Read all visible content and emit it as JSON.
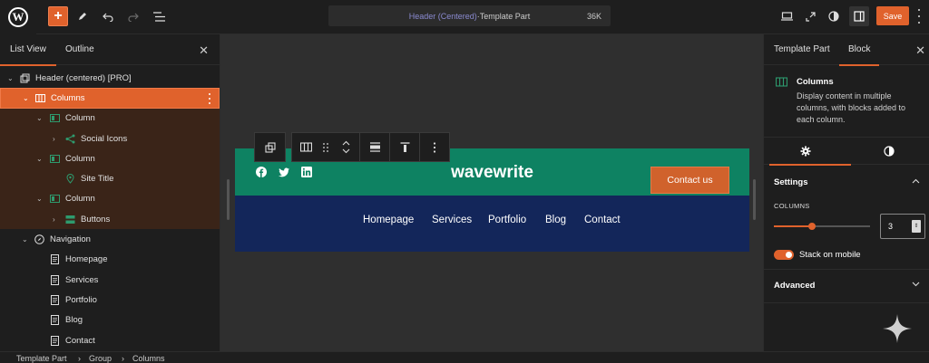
{
  "topbar": {
    "doc_title_part1": "Header (Centered)",
    "doc_title_sep": " · ",
    "doc_title_part2": "Template Part",
    "shortcut": "36K",
    "save_label": "Save"
  },
  "left_panel": {
    "tabs": [
      {
        "label": "List View"
      },
      {
        "label": "Outline"
      }
    ],
    "tree": [
      {
        "label": "Header (centered) [PRO]",
        "icon": "template-part-icon"
      },
      {
        "label": "Columns",
        "icon": "columns-icon"
      },
      {
        "label": "Column",
        "icon": "column-icon"
      },
      {
        "label": "Social Icons",
        "icon": "share-icon"
      },
      {
        "label": "Column",
        "icon": "column-icon"
      },
      {
        "label": "Site Title",
        "icon": "map-pin-icon"
      },
      {
        "label": "Column",
        "icon": "column-icon"
      },
      {
        "label": "Buttons",
        "icon": "buttons-icon"
      },
      {
        "label": "Navigation",
        "icon": "compass-icon"
      },
      {
        "label": "Homepage",
        "icon": "page-icon"
      },
      {
        "label": "Services",
        "icon": "page-icon"
      },
      {
        "label": "Portfolio",
        "icon": "page-icon"
      },
      {
        "label": "Blog",
        "icon": "page-icon"
      },
      {
        "label": "Contact",
        "icon": "page-icon"
      }
    ]
  },
  "canvas": {
    "brand": "wavewrite",
    "contact_button": "Contact us",
    "nav": [
      "Homepage",
      "Services",
      "Portfolio",
      "Blog",
      "Contact"
    ],
    "social": [
      "facebook-icon",
      "twitter-icon",
      "linkedin-icon"
    ]
  },
  "right_panel": {
    "tabs": [
      {
        "label": "Template Part"
      },
      {
        "label": "Block"
      }
    ],
    "block_name": "Columns",
    "block_desc": "Display content in multiple columns, with blocks added to each column.",
    "settings_title": "Settings",
    "columns_label": "COLUMNS",
    "columns_value": "3",
    "columns_slider_fraction": 0.5,
    "stack_label": "Stack on mobile",
    "stack_on": true,
    "advanced_title": "Advanced"
  },
  "breadcrumb": [
    "Template Part",
    "Group",
    "Columns"
  ],
  "colors": {
    "accent": "#e0622c",
    "header_green": "#0e8262",
    "header_navy": "#13265a"
  }
}
